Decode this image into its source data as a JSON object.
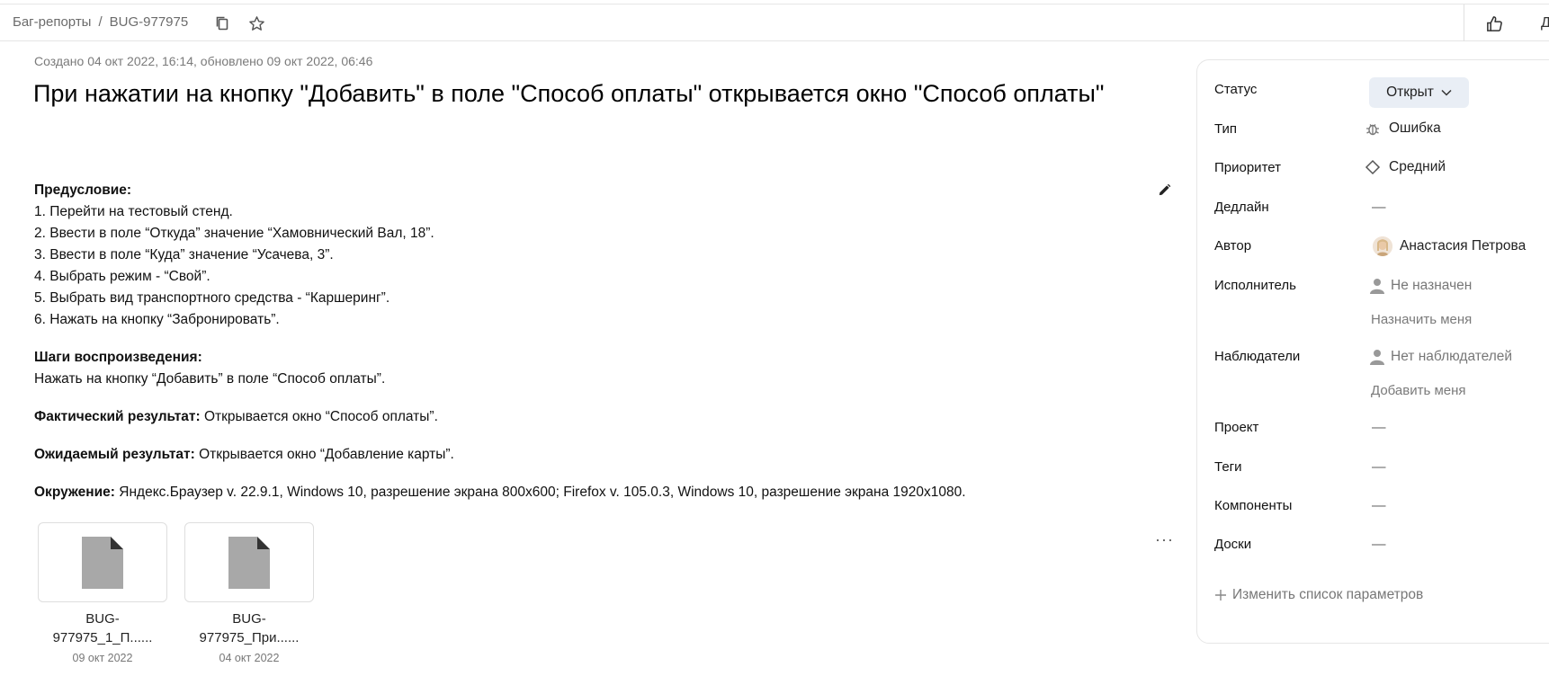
{
  "breadcrumb": {
    "parent": "Баг-репорты",
    "separator": "/",
    "issue_key": "BUG-977975"
  },
  "topbar": {
    "cut_button_label": "Д"
  },
  "meta": "Создано 04 окт 2022, 16:14, обновлено 09 окт 2022, 06:46",
  "title": "При нажатии на кнопку \"Добавить\" в поле \"Способ оплаты\" открывается окно \"Способ оплаты\"",
  "description": {
    "precondition_heading": "Предусловие:",
    "precondition_steps": [
      "1. Перейти на тестовый стенд.",
      "2. Ввести в поле “Откуда” значение “Хамовнический Вал, 18”.",
      "3. Ввести в поле “Куда” значение “Усачева, 3”.",
      "4. Выбрать режим - “Свой”.",
      "5. Выбрать вид транспортного средства - “Каршеринг”.",
      "6. Нажать на кнопку “Забронировать”."
    ],
    "steps_heading": "Шаги воспроизведения:",
    "steps_text": "Нажать на кнопку “Добавить” в поле “Способ оплаты”.",
    "actual_label": "Фактический результат:",
    "actual_text": " Открывается окно “Способ оплаты”.",
    "expected_label": "Ожидаемый результат:",
    "expected_text": " Открывается окно “Добавление карты”.",
    "env_label": "Окружение:",
    "env_text": " Яндекс.Браузер v. 22.9.1, Windows 10, разрешение экрана 800х600; Firefox v. 105.0.3, Windows 10, разрешение экрана 1920х1080."
  },
  "more_label": "···",
  "attachments": [
    {
      "name_line1": "BUG-",
      "name_line2": "977975_1_П......",
      "date": "09 окт 2022"
    },
    {
      "name_line1": "BUG-",
      "name_line2": "977975_При......",
      "date": "04 окт 2022"
    }
  ],
  "panel": {
    "status": {
      "label": "Статус",
      "value": "Открыт"
    },
    "type": {
      "label": "Тип",
      "value": "Ошибка"
    },
    "priority": {
      "label": "Приоритет",
      "value": "Средний"
    },
    "deadline": {
      "label": "Дедлайн",
      "value": "—"
    },
    "author": {
      "label": "Автор",
      "value": "Анастасия Петрова"
    },
    "assignee": {
      "label": "Исполнитель",
      "value": "Не назначен",
      "action": "Назначить меня"
    },
    "watchers": {
      "label": "Наблюдатели",
      "value": "Нет наблюдателей",
      "action": "Добавить меня"
    },
    "project": {
      "label": "Проект",
      "value": "—"
    },
    "tags": {
      "label": "Теги",
      "value": "—"
    },
    "components": {
      "label": "Компоненты",
      "value": "—"
    },
    "boards": {
      "label": "Доски",
      "value": "—"
    },
    "edit_params": "Изменить список параметров"
  }
}
